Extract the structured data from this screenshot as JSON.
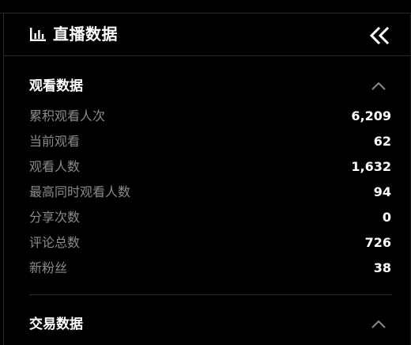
{
  "panel": {
    "title": "直播数据",
    "icon": "bar-chart-icon",
    "collapse_icon": "double-chevron-left-icon"
  },
  "sections": [
    {
      "title": "观看数据",
      "expanded": true,
      "toggle_icon": "chevron-up-icon",
      "metrics": [
        {
          "label": "累积观看人次",
          "value": "6,209"
        },
        {
          "label": "当前观看",
          "value": "62"
        },
        {
          "label": "观看人数",
          "value": "1,632"
        },
        {
          "label": "最高同时观看人数",
          "value": "94"
        },
        {
          "label": "分享次数",
          "value": "0"
        },
        {
          "label": "评论总数",
          "value": "726"
        },
        {
          "label": "新粉丝",
          "value": "38"
        }
      ]
    },
    {
      "title": "交易数据",
      "expanded": true,
      "toggle_icon": "chevron-up-icon"
    }
  ],
  "colors": {
    "background": "#000000",
    "text_primary": "#ffffff",
    "text_secondary": "#8a8a8a",
    "border": "#2b2b2b"
  }
}
